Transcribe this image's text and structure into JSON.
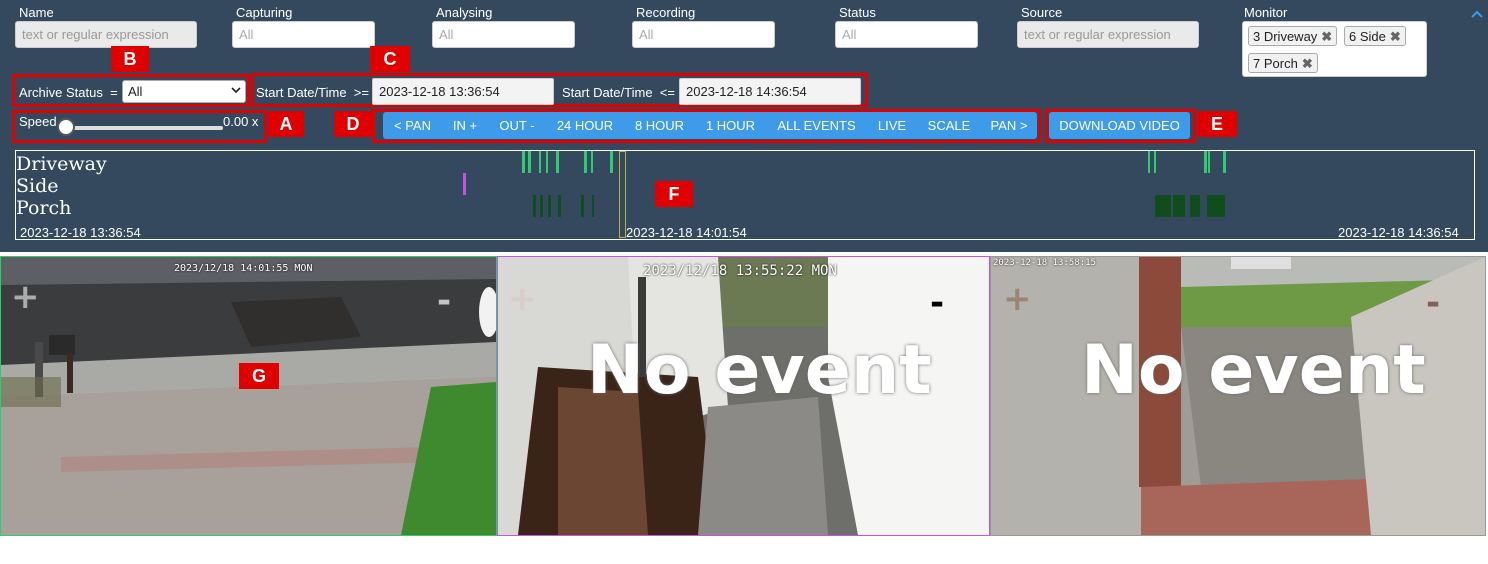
{
  "filters": {
    "name": {
      "label": "Name",
      "placeholder": "text or regular expression"
    },
    "capturing": {
      "label": "Capturing",
      "value": "All"
    },
    "analysing": {
      "label": "Analysing",
      "value": "All"
    },
    "recording": {
      "label": "Recording",
      "value": "All"
    },
    "status": {
      "label": "Status",
      "value": "All"
    },
    "source": {
      "label": "Source",
      "placeholder": "text or regular expression"
    },
    "monitor": {
      "label": "Monitor",
      "tags": [
        "3 Driveway",
        "6 Side",
        "7 Porch"
      ],
      "remove_glyph": "✖"
    }
  },
  "collapse_icon": "chevron-up-icon",
  "archive": {
    "label": "Archive Status",
    "operator": "=",
    "value": "All"
  },
  "start_from": {
    "label": "Start Date/Time",
    "operator": ">=",
    "value": "2023-12-18 13:36:54"
  },
  "start_to": {
    "label": "Start Date/Time",
    "operator": "<=",
    "value": "2023-12-18 14:36:54"
  },
  "speed": {
    "label": "Speed",
    "value": "0.00 x",
    "level": 0
  },
  "nav_buttons": [
    "< PAN",
    "IN +",
    "OUT -",
    "24 HOUR",
    "8 HOUR",
    "1 HOUR",
    "ALL EVENTS",
    "LIVE",
    "SCALE",
    "PAN >"
  ],
  "download_button": "DOWNLOAD VIDEO",
  "annotations": [
    "A",
    "B",
    "C",
    "D",
    "E",
    "F",
    "G"
  ],
  "timeline": {
    "rows": [
      "Driveway",
      "Side",
      "Porch"
    ],
    "start_label": "2023-12-18 13:36:54",
    "mid_label": "2023-12-18 14:01:54",
    "end_label": "2023-12-18 14:36:54"
  },
  "cameras": [
    {
      "timestamp": "2023/12/18 14:01:55 MON",
      "overlay": ""
    },
    {
      "timestamp": "2023/12/18 13:55:22 MON",
      "overlay": "No event"
    },
    {
      "timestamp": "2023-12-18 13:58:15",
      "overlay": "No event"
    }
  ],
  "zoom": {
    "plus": "+",
    "minus": "-"
  },
  "colors": {
    "header_bg": "#34495e",
    "button": "#3d9be9",
    "annotation": "#e00000",
    "driveway": "#2ecc71",
    "porch": "#0f4d1d",
    "side": "#c653e0",
    "cursor": "#b5b33a"
  }
}
